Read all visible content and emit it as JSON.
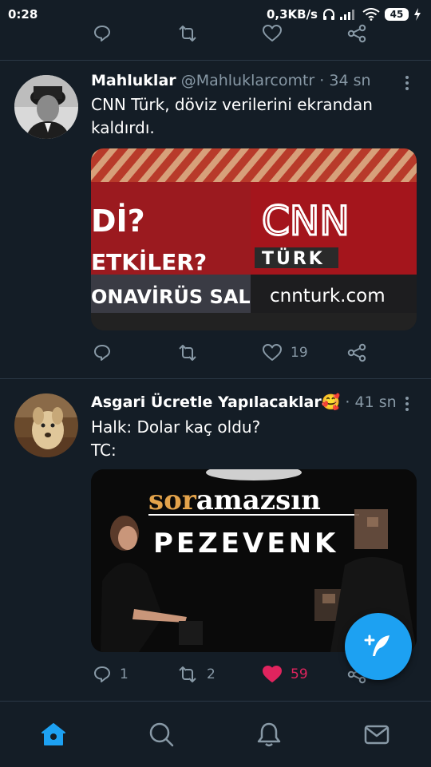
{
  "status_bar": {
    "time": "0:28",
    "network_speed": "0,3KB/s",
    "battery": "45"
  },
  "tweets": [
    {
      "name": "Mahluklar",
      "handle": "@Mahluklarcomtr",
      "separator": "·",
      "time": "34 sn",
      "text": "CNN Türk, döviz verilerini ekrandan kaldırdı.",
      "media": {
        "headline_1": "Dİ?",
        "headline_2": "ETKİLER?",
        "ticker": "ONAVİRÜS SAL",
        "logo_top": "CNN",
        "logo_bottom": "TÜRK",
        "url": "cnnturk.com"
      },
      "replies": "",
      "retweets": "",
      "likes": "19"
    },
    {
      "name": "Asgari Ücretle Yapılacaklar",
      "emoji": "🥰",
      "separator": "·",
      "time": "41 sn",
      "text_line1": "Halk: Dolar kaç oldu?",
      "text_line2": "TC:",
      "media": {
        "title_highlight": "sor",
        "title_rest": "amazsın",
        "subtitle": "PEZEVENK"
      },
      "replies": "1",
      "retweets": "2",
      "likes": "59"
    }
  ],
  "colors": {
    "background": "#141d26",
    "accent": "#1da1f2",
    "like_active": "#e0245e",
    "muted": "#8899a6"
  },
  "icons": {
    "fab": "compose-tweet-icon",
    "nav": [
      "home-icon",
      "search-icon",
      "notifications-icon",
      "messages-icon"
    ]
  }
}
